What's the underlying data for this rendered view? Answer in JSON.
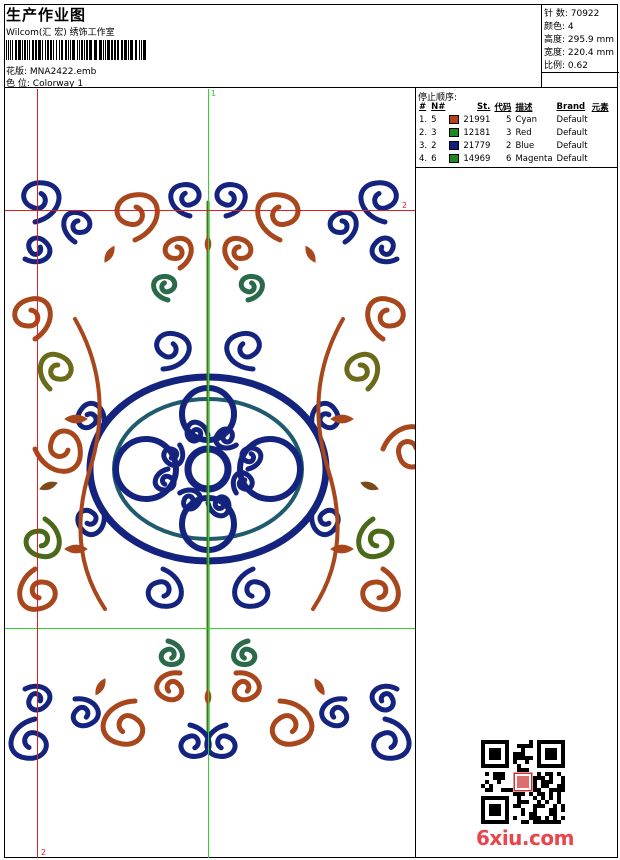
{
  "header": {
    "title": "生产作业图",
    "company": "Wilcom(汇 宏) 绣饰工作室",
    "design_label": "花版:",
    "design_file": "MNA2422.emb",
    "colorway_label": "色 位:",
    "colorway_value": "Colorway 1"
  },
  "info": {
    "stitches": "针 数: 70922",
    "colors": "颜色: 4",
    "height": "高度: 295.9 mm",
    "width": "宽度: 220.4 mm",
    "scale": "比例: 0.62"
  },
  "stop_sequence": {
    "title": "停止顺序:",
    "headers": [
      "#",
      "N#",
      "St.",
      "代码",
      "描述",
      "Brand",
      "元素"
    ],
    "rows": [
      {
        "num": "1.",
        "n": "5",
        "swatch": "#b5401a",
        "stitches": "21991",
        "code": "5",
        "desc": "Cyan",
        "brand": "Default"
      },
      {
        "num": "2.",
        "n": "3",
        "swatch": "#1d8a1d",
        "stitches": "12181",
        "code": "3",
        "desc": "Red",
        "brand": "Default"
      },
      {
        "num": "3.",
        "n": "2",
        "swatch": "#101f80",
        "stitches": "21779",
        "code": "2",
        "desc": "Blue",
        "brand": "Default"
      },
      {
        "num": "4.",
        "n": "6",
        "swatch": "#1d8a1d",
        "stitches": "14969",
        "code": "6",
        "desc": "Magenta",
        "brand": "Default"
      }
    ]
  },
  "guides": {
    "v1_label": "1",
    "h2_label": "2",
    "v2_label": "2"
  },
  "watermark": "6xiu.com",
  "colors": {
    "blue": "#14237e",
    "brown": "#a8461c",
    "green": "#3c7a1c",
    "guide_green": "#2cd42c",
    "guide_red": "#e02020"
  }
}
